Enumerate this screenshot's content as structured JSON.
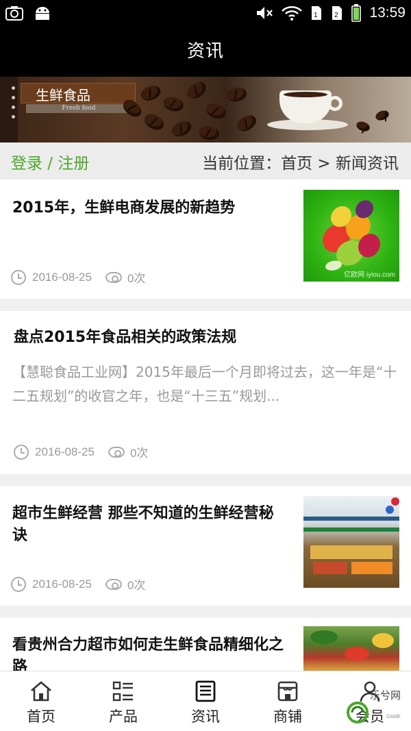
{
  "status_bar": {
    "time": "13:59",
    "icons": [
      "screenshot-icon",
      "android-icon",
      "mute-icon",
      "wifi-icon",
      "sim1-icon",
      "sim2-icon",
      "battery-icon"
    ]
  },
  "header": {
    "title": "资讯"
  },
  "banner": {
    "title_cn": "生鲜食品",
    "title_en": "Fresh food"
  },
  "breadcrumb": {
    "login_link": "登录 / 注册",
    "location": "当前位置：首页 > 新闻资讯"
  },
  "articles": [
    {
      "title": "2015年，生鲜电商发展的新趋势",
      "date": "2016-08-25",
      "views": "0次",
      "thumb_watermark": "亿欧网 iyiou.com"
    },
    {
      "title": "盘点2015年食品相关的政策法规",
      "summary": "【慧聪食品工业网】2015年最后一个月即将过去，这一年是“十二五规划”的收官之年，也是“十三五”规划...",
      "date": "2016-08-25",
      "views": "0次"
    },
    {
      "title": "超市生鲜经营 那些不知道的生鲜经营秘诀",
      "date": "2016-08-25",
      "views": "0次"
    },
    {
      "title": "看贵州合力超市如何走生鲜食品精细化之路"
    }
  ],
  "nav": {
    "items": [
      {
        "label": "首页",
        "icon": "home-icon"
      },
      {
        "label": "产品",
        "icon": "list-icon"
      },
      {
        "label": "资讯",
        "icon": "news-icon"
      },
      {
        "label": "商铺",
        "icon": "store-icon"
      },
      {
        "label": "会员",
        "icon": "user-icon"
      }
    ]
  },
  "watermark": {
    "text": "乐兮网",
    "sub": "GAME"
  },
  "colors": {
    "accent_green": "#4aa82b",
    "header_bg": "#000000"
  }
}
